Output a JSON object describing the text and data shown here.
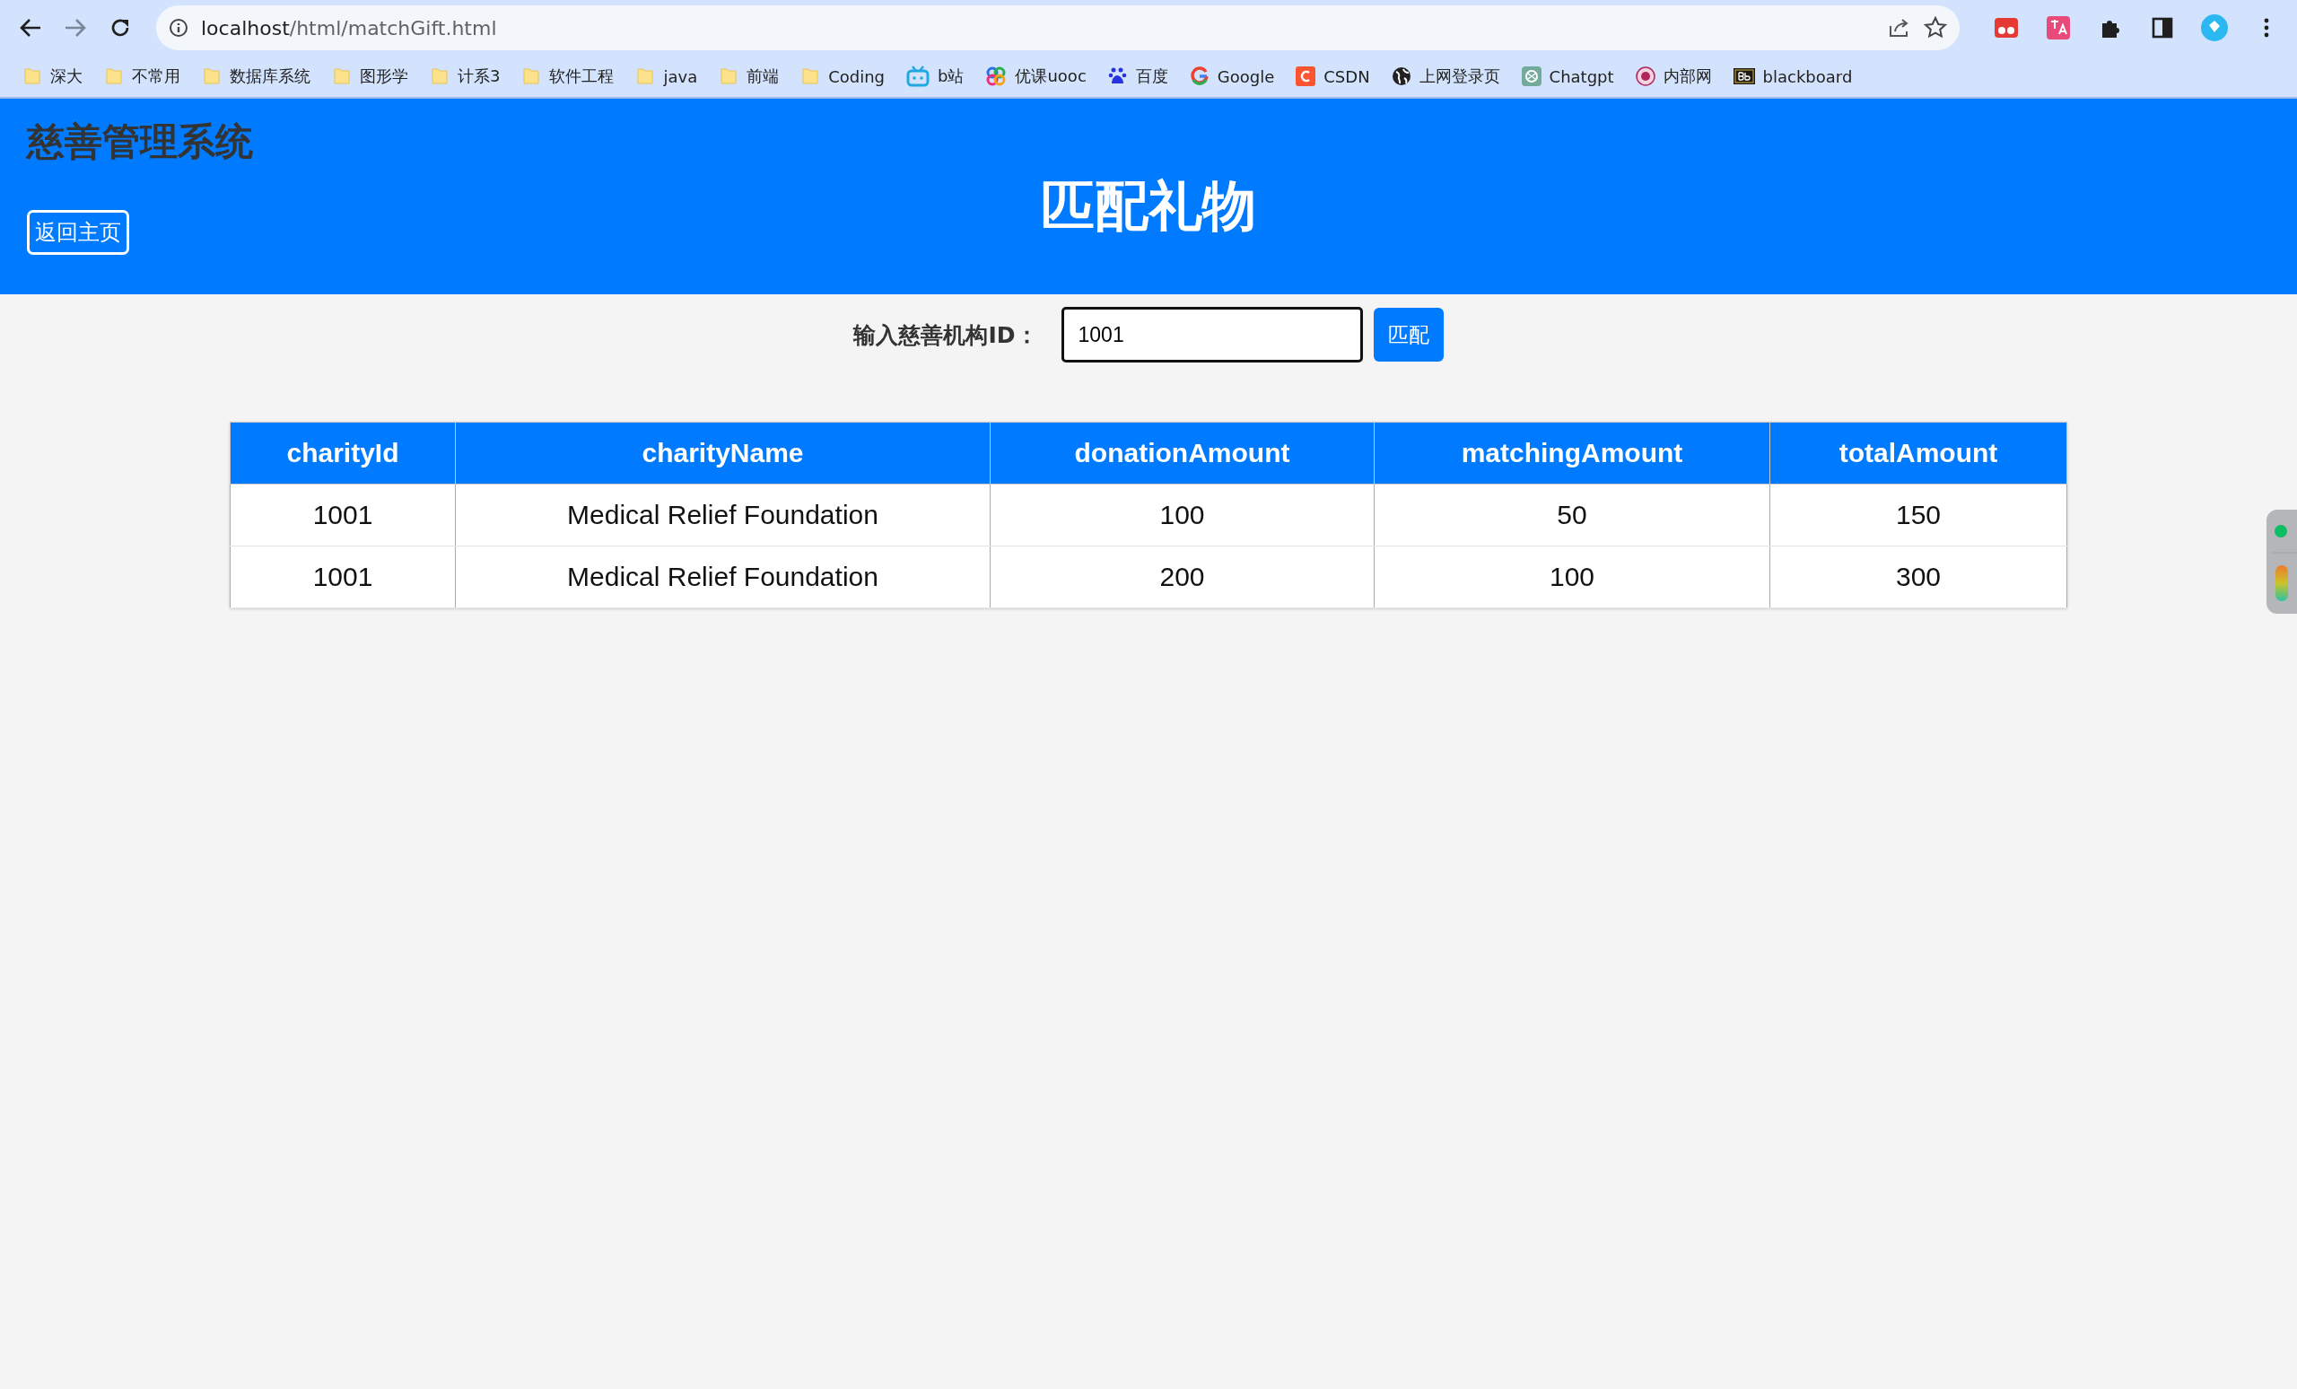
{
  "browser": {
    "url_host": "localhost",
    "url_path": "/html/matchGift.html",
    "bookmarks": [
      {
        "label": "深大",
        "kind": "folder"
      },
      {
        "label": "不常用",
        "kind": "folder"
      },
      {
        "label": "数据库系统",
        "kind": "folder"
      },
      {
        "label": "图形学",
        "kind": "folder"
      },
      {
        "label": "计系3",
        "kind": "folder"
      },
      {
        "label": "软件工程",
        "kind": "folder"
      },
      {
        "label": "java",
        "kind": "folder"
      },
      {
        "label": "前端",
        "kind": "folder"
      },
      {
        "label": "Coding",
        "kind": "folder"
      },
      {
        "label": "b站",
        "kind": "tv"
      },
      {
        "label": "优课uooc",
        "kind": "rings"
      },
      {
        "label": "百度",
        "kind": "paw"
      },
      {
        "label": "Google",
        "kind": "g"
      },
      {
        "label": "CSDN",
        "kind": "c"
      },
      {
        "label": "上网登录页",
        "kind": "globe"
      },
      {
        "label": "Chatgpt",
        "kind": "knot"
      },
      {
        "label": "内部网",
        "kind": "seal"
      },
      {
        "label": "blackboard",
        "kind": "bb"
      }
    ]
  },
  "header": {
    "system_title": "慈善管理系统",
    "back_button": "返回主页",
    "page_title": "匹配礼物"
  },
  "form": {
    "label": "输入慈善机构ID：",
    "value": "1001",
    "button": "匹配"
  },
  "table": {
    "columns": [
      "charityId",
      "charityName",
      "donationAmount",
      "matchingAmount",
      "totalAmount"
    ],
    "rows": [
      [
        "1001",
        "Medical Relief Foundation",
        "100",
        "50",
        "150"
      ],
      [
        "1001",
        "Medical Relief Foundation",
        "200",
        "100",
        "300"
      ]
    ]
  }
}
